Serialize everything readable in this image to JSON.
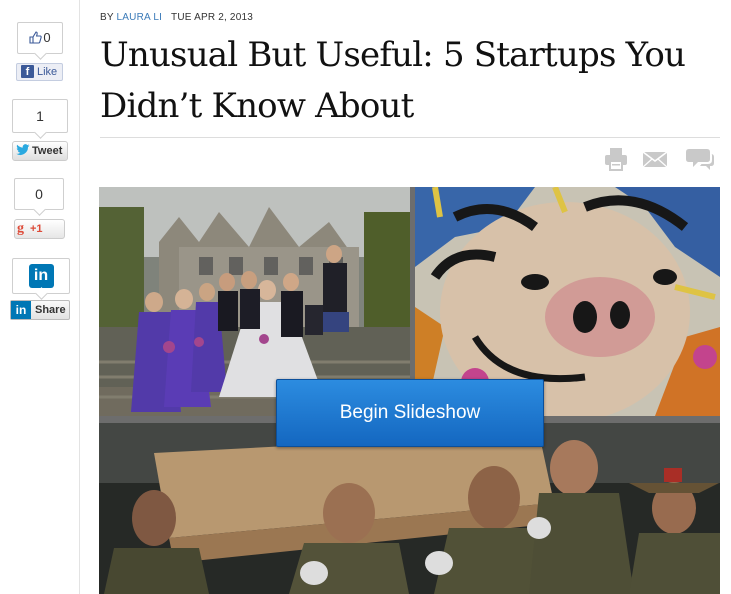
{
  "share": {
    "facebook": {
      "count": "0",
      "button_label": "Like",
      "logo_letter": "f"
    },
    "twitter": {
      "count": "1",
      "button_label": "Tweet"
    },
    "google": {
      "count": "0",
      "logo_letter": "g",
      "button_label": "+1"
    },
    "linkedin": {
      "logo_text": "in",
      "button_label": "Share"
    }
  },
  "article": {
    "by_prefix": "BY",
    "author": "LAURA LI",
    "date": "TUE APR 2, 2013",
    "headline": "Unusual But Useful: 5 Startups You Didn’t Know About"
  },
  "tools": [
    "printer-icon",
    "email-icon",
    "comment-icon"
  ],
  "slideshow": {
    "button_label": "Begin Slideshow"
  },
  "colors": {
    "accent_blue": "#1a74cf",
    "author_link": "#3a7ab8",
    "facebook": "#3b5998",
    "twitter": "#2aa9e0",
    "google": "#dd4b39",
    "linkedin": "#0077b5"
  }
}
